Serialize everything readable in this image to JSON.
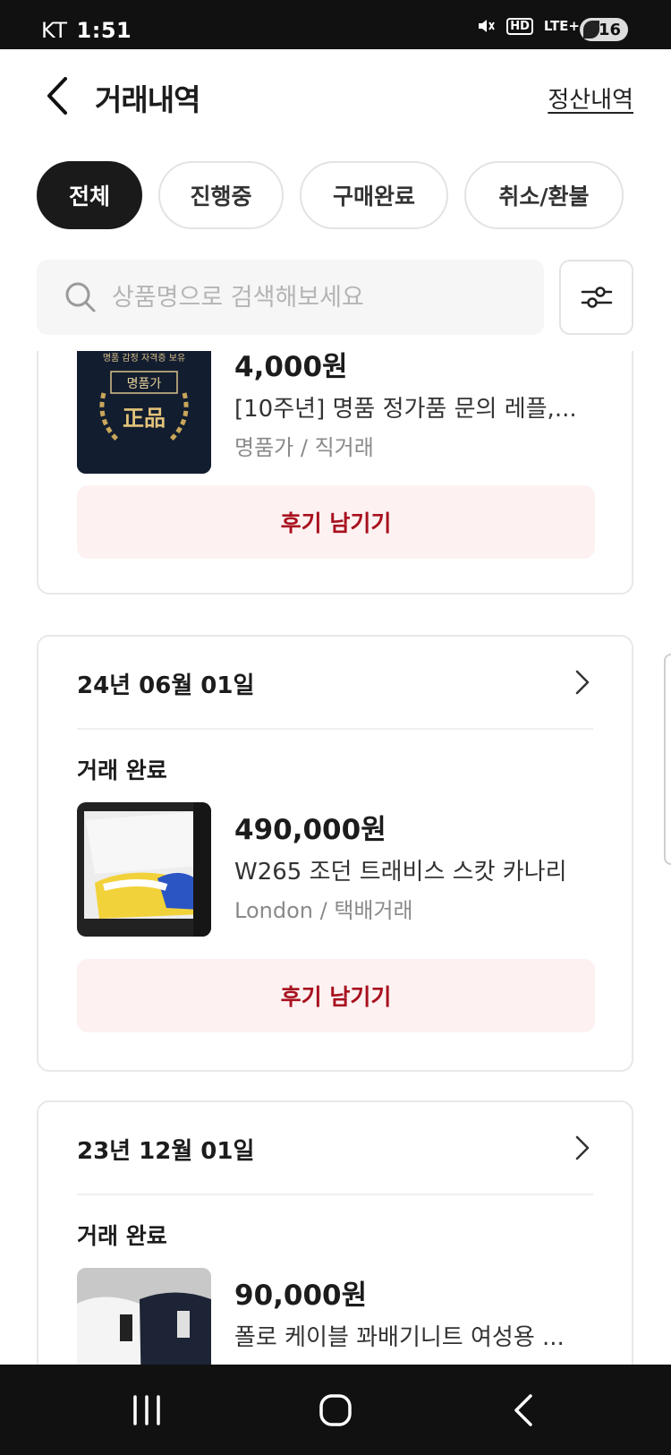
{
  "status_bar": {
    "carrier": "KT",
    "time": "1:51",
    "network": "LTE+",
    "hd": "HD",
    "battery": "16",
    "icons": [
      "mute-icon",
      "hd-voice-icon",
      "lte-icon",
      "signal-icon",
      "battery-icon"
    ]
  },
  "header": {
    "title": "거래내역",
    "settlement_link": "정산내역"
  },
  "tabs": [
    {
      "label": "전체",
      "active": true
    },
    {
      "label": "진행중",
      "active": false
    },
    {
      "label": "구매완료",
      "active": false
    },
    {
      "label": "취소/환불",
      "active": false
    }
  ],
  "search": {
    "placeholder": "상품명으로 검색해보세요",
    "value": ""
  },
  "transactions": [
    {
      "date": "",
      "status": "",
      "price": "4,000원",
      "name": "[10주년] 명품 정가품 문의 레플,...",
      "meta": "명품가 / 직거래",
      "thumb_text": {
        "top": "명품 감정 자격증 보유",
        "badge": "명품가",
        "main": "正品"
      },
      "review_label": "후기 남기기"
    },
    {
      "date": "24년 06월 01일",
      "status": "거래 완료",
      "price": "490,000원",
      "name": "W265 조던 트래비스 스캇 카나리",
      "meta": "London / 택배거래",
      "review_label": "후기 남기기"
    },
    {
      "date": "23년 12월 01일",
      "status": "거래 완료",
      "price": "90,000원",
      "name": "폴로 케이블 꽈배기니트 여성용 ...",
      "meta": "",
      "review_label": ""
    }
  ],
  "colors": {
    "accent_text": "#a8101e",
    "review_bg": "#fdf1f1",
    "active_tab": "#1a1a1a"
  }
}
